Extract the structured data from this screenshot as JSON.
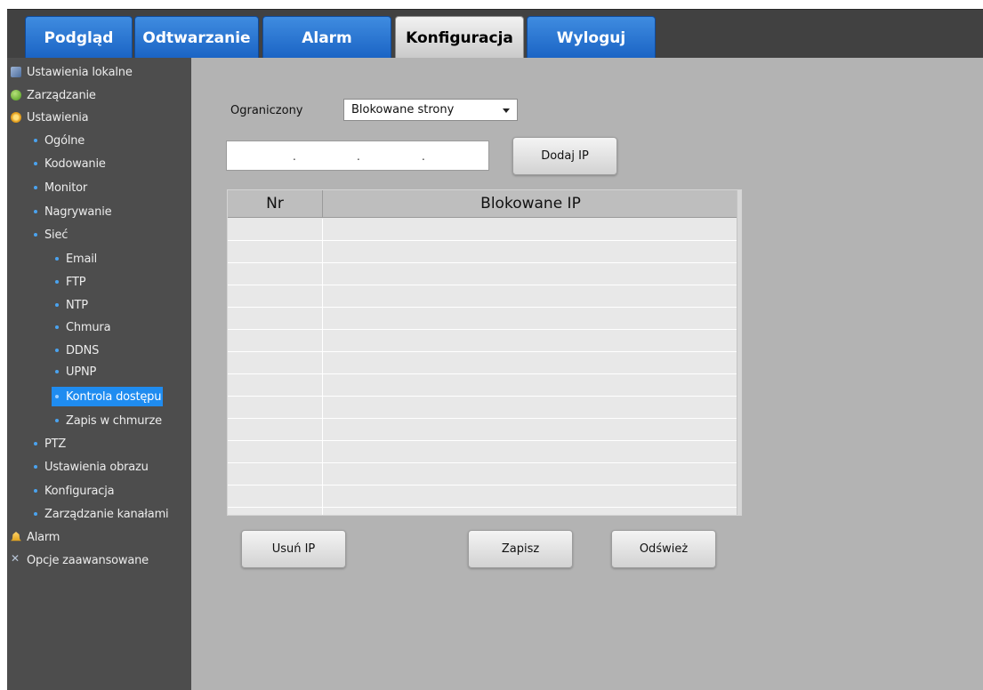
{
  "tabs": [
    {
      "label": "Podgląd",
      "active": false
    },
    {
      "label": "Odtwarzanie",
      "active": false
    },
    {
      "label": "Alarm",
      "active": false
    },
    {
      "label": "Konfiguracja",
      "active": true
    },
    {
      "label": "Wyloguj",
      "active": false
    }
  ],
  "sidebar": {
    "items": [
      {
        "label": "Ustawienia lokalne",
        "icon": "monitor-icon"
      },
      {
        "label": "Zarządzanie",
        "icon": "info-icon"
      },
      {
        "label": "Ustawienia",
        "icon": "gear-icon"
      },
      {
        "label": "Ogólne"
      },
      {
        "label": "Kodowanie"
      },
      {
        "label": "Monitor"
      },
      {
        "label": "Nagrywanie"
      },
      {
        "label": "Sieć"
      },
      {
        "label": "Email"
      },
      {
        "label": "FTP"
      },
      {
        "label": "NTP"
      },
      {
        "label": "Chmura"
      },
      {
        "label": "DDNS"
      },
      {
        "label": "UPNP"
      },
      {
        "label": "Kontrola dostępu",
        "selected": true
      },
      {
        "label": "Zapis w chmurze"
      },
      {
        "label": "PTZ"
      },
      {
        "label": "Ustawienia obrazu"
      },
      {
        "label": "Konfiguracja"
      },
      {
        "label": "Zarządzanie kanałami"
      },
      {
        "label": "Alarm",
        "icon": "bell-icon"
      },
      {
        "label": "Opcje zaawansowane",
        "icon": "tools-icon"
      }
    ]
  },
  "main": {
    "restrict_label": "Ograniczony",
    "restrict_select": {
      "selected": "Blokowane strony"
    },
    "ip_input": {
      "dots": ".   .   ."
    },
    "add_ip_button": "Dodaj IP",
    "table": {
      "headers": [
        "Nr",
        "Blokowane IP"
      ],
      "rows": []
    },
    "buttons": {
      "delete_ip": "Usuń IP",
      "save": "Zapisz",
      "refresh": "Odśwież"
    }
  },
  "colors": {
    "tab_blue": "#1f6fd0",
    "tab_active": "#d9d9d9",
    "sidebar_bg": "#4d4d4d",
    "selection": "#1f8cf0",
    "content_bg": "#b3b3b3"
  }
}
